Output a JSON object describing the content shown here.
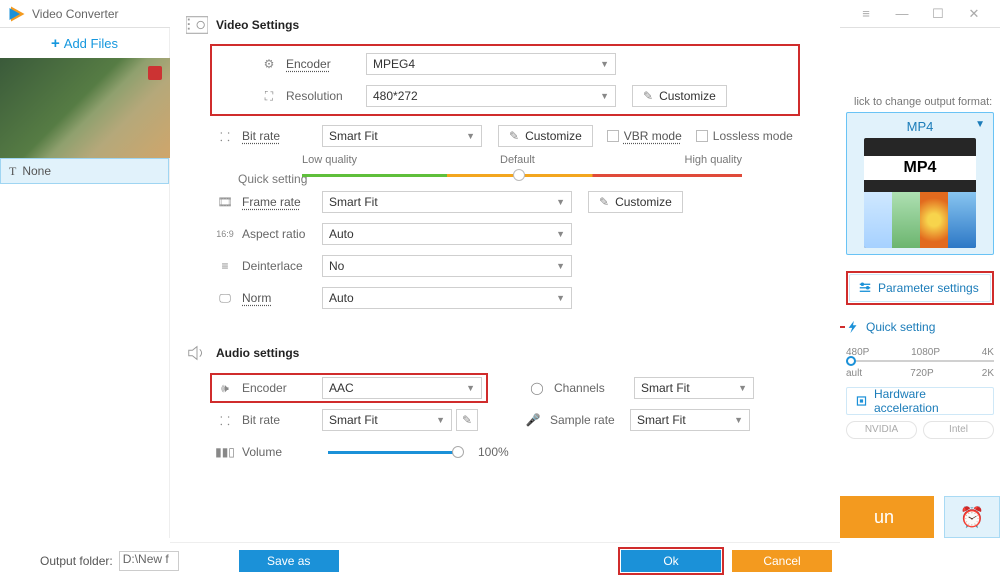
{
  "titlebar": {
    "title": "Video Converter"
  },
  "sidebar": {
    "add_files": "Add Files",
    "file_label": "None"
  },
  "right": {
    "hint": "lick to change output format:",
    "format": "MP4",
    "format_art": "MP4",
    "param_btn": "Parameter settings",
    "quick_btn": "Quick setting",
    "ticks1": [
      "480P",
      "1080P",
      "4K"
    ],
    "ticks2": [
      "ault",
      "720P",
      "2K"
    ],
    "hw_btn": "Hardware acceleration",
    "gpu": [
      "NVIDIA",
      "Intel"
    ],
    "run": "un"
  },
  "video": {
    "heading": "Video Settings",
    "encoder_lbl": "Encoder",
    "encoder_val": "MPEG4",
    "resolution_lbl": "Resolution",
    "resolution_val": "480*272",
    "customize": "Customize",
    "bitrate_lbl": "Bit rate",
    "bitrate_val": "Smart Fit",
    "vbr": "VBR mode",
    "lossless": "Lossless mode",
    "quick_setting_lbl": "Quick setting",
    "q_low": "Low quality",
    "q_def": "Default",
    "q_high": "High quality",
    "framerate_lbl": "Frame rate",
    "framerate_val": "Smart Fit",
    "aspect_lbl": "Aspect ratio",
    "aspect_val": "Auto",
    "deint_lbl": "Deinterlace",
    "deint_val": "No",
    "norm_lbl": "Norm",
    "norm_val": "Auto"
  },
  "audio": {
    "heading": "Audio settings",
    "encoder_lbl": "Encoder",
    "encoder_val": "AAC",
    "channels_lbl": "Channels",
    "channels_val": "Smart Fit",
    "bitrate_lbl": "Bit rate",
    "bitrate_val": "Smart Fit",
    "sample_lbl": "Sample rate",
    "sample_val": "Smart Fit",
    "volume_lbl": "Volume",
    "volume_pct": "100%"
  },
  "footer": {
    "output_lbl": "Output folder:",
    "output_val": "D:\\New f",
    "save_as": "Save as",
    "ok": "Ok",
    "cancel": "Cancel"
  }
}
